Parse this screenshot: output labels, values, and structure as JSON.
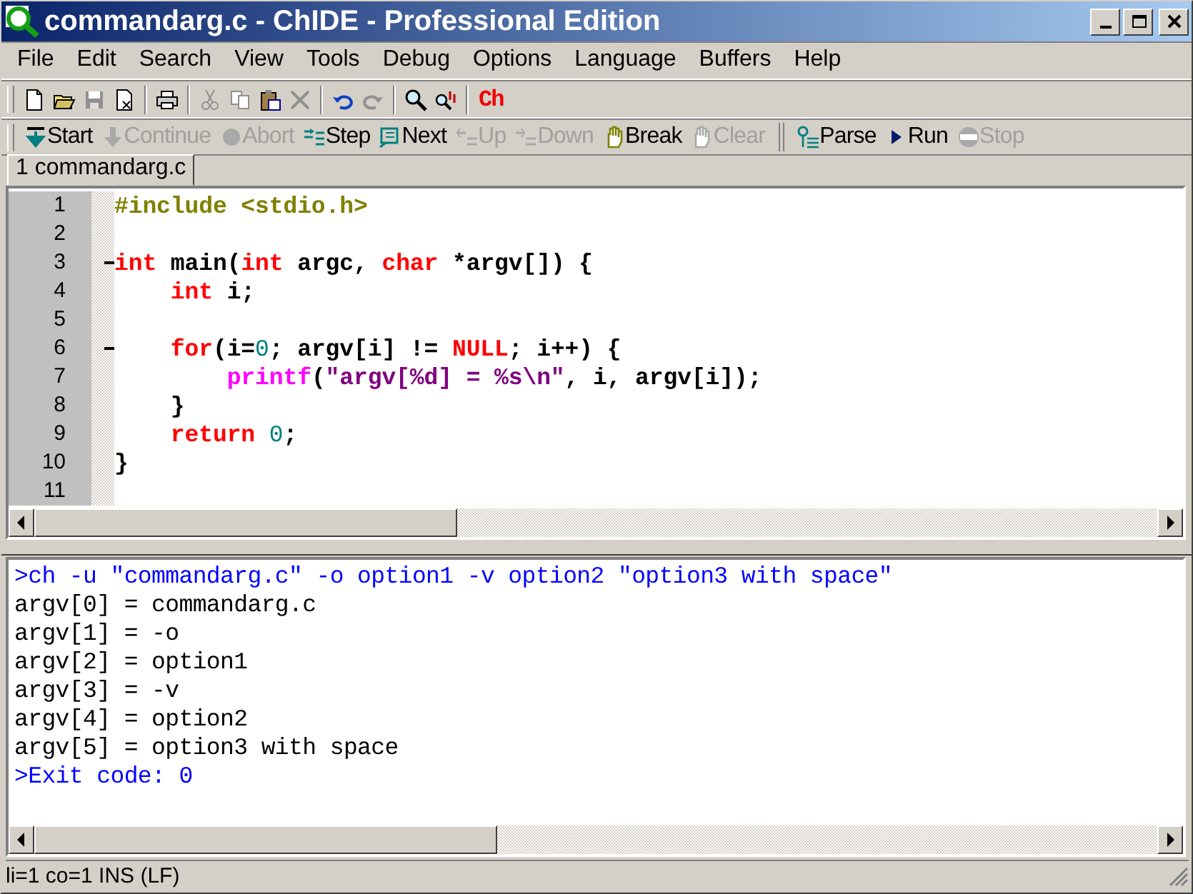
{
  "window": {
    "title": "commandarg.c - ChIDE - Professional Edition"
  },
  "menu": [
    "File",
    "Edit",
    "Search",
    "View",
    "Tools",
    "Debug",
    "Options",
    "Language",
    "Buffers",
    "Help"
  ],
  "toolbar": [
    {
      "kind": "icon",
      "disabled": false
    },
    {
      "kind": "icon",
      "disabled": false
    },
    {
      "kind": "icon",
      "disabled": true
    },
    {
      "kind": "icon",
      "disabled": false
    },
    {
      "kind": "separator"
    },
    {
      "kind": "icon",
      "disabled": false
    },
    {
      "kind": "separator"
    },
    {
      "kind": "icon",
      "disabled": true
    },
    {
      "kind": "icon",
      "disabled": true
    },
    {
      "kind": "icon",
      "disabled": false
    },
    {
      "kind": "icon",
      "disabled": true
    },
    {
      "kind": "separator"
    },
    {
      "kind": "icon",
      "disabled": false
    },
    {
      "kind": "icon",
      "disabled": true
    },
    {
      "kind": "separator"
    },
    {
      "kind": "icon",
      "disabled": false
    },
    {
      "kind": "icon",
      "disabled": false
    },
    {
      "kind": "separator"
    },
    {
      "kind": "text",
      "label": "Ch",
      "disabled": false
    }
  ],
  "debug_toolbar": [
    {
      "kind": "button",
      "label": "Start",
      "disabled": false
    },
    {
      "kind": "button",
      "label": "Continue",
      "disabled": true
    },
    {
      "kind": "button",
      "label": "Abort",
      "disabled": true
    },
    {
      "kind": "button",
      "label": "Step",
      "disabled": false
    },
    {
      "kind": "button",
      "label": "Next",
      "disabled": false
    },
    {
      "kind": "button",
      "label": "Up",
      "disabled": true
    },
    {
      "kind": "button",
      "label": "Down",
      "disabled": true
    },
    {
      "kind": "button",
      "label": "Break",
      "disabled": false
    },
    {
      "kind": "button",
      "label": "Clear",
      "disabled": true
    },
    {
      "kind": "separator"
    },
    {
      "kind": "button",
      "label": "Parse",
      "disabled": false
    },
    {
      "kind": "button",
      "label": "Run",
      "disabled": false
    },
    {
      "kind": "button",
      "label": "Stop",
      "disabled": true
    }
  ],
  "tabs": [
    {
      "label": "1 commandarg.c",
      "selected": true
    }
  ],
  "editor": {
    "lines": [
      {
        "number": "1",
        "fold": false,
        "tokens": [
          {
            "kind": "preprocessor",
            "text": "#include <stdio.h>"
          }
        ]
      },
      {
        "number": "2",
        "fold": false
      },
      {
        "number": "3",
        "fold": true,
        "tokens": [
          {
            "kind": "keyword",
            "text": "int"
          },
          {
            "kind": "plain",
            "text": " main("
          },
          {
            "kind": "keyword",
            "text": "int"
          },
          {
            "kind": "plain",
            "text": " argc, "
          },
          {
            "kind": "keyword",
            "text": "char"
          },
          {
            "kind": "plain",
            "text": " *argv[]) {"
          }
        ]
      },
      {
        "number": "4",
        "fold": false,
        "tokens": [
          {
            "kind": "keyword",
            "text": "    int"
          },
          {
            "kind": "plain",
            "text": " i;"
          }
        ]
      },
      {
        "number": "5",
        "fold": false
      },
      {
        "number": "6",
        "fold": true,
        "tokens": [
          {
            "kind": "keyword",
            "text": "    for"
          },
          {
            "kind": "plain",
            "text": "(i="
          },
          {
            "kind": "number",
            "text": "0"
          },
          {
            "kind": "plain",
            "text": "; argv[i] != "
          },
          {
            "kind": "keyword",
            "text": "NULL"
          },
          {
            "kind": "plain",
            "text": "; i++) {"
          }
        ]
      },
      {
        "number": "7",
        "fold": false,
        "tokens": [
          {
            "kind": "function",
            "text": "        printf"
          },
          {
            "kind": "plain",
            "text": "("
          },
          {
            "kind": "string",
            "text": "\"argv[%d] = %s\\n\""
          },
          {
            "kind": "plain",
            "text": ", i, argv[i]);"
          }
        ]
      },
      {
        "number": "8",
        "fold": false,
        "tokens": [
          {
            "kind": "plain",
            "text": "    }"
          }
        ]
      },
      {
        "number": "9",
        "fold": false,
        "tokens": [
          {
            "kind": "keyword",
            "text": "    return"
          },
          {
            "kind": "number",
            "text": " 0"
          },
          {
            "kind": "plain",
            "text": ";"
          }
        ]
      },
      {
        "number": "10",
        "fold": false,
        "tokens": [
          {
            "kind": "plain",
            "text": "}"
          }
        ]
      },
      {
        "number": "11",
        "fold": false
      }
    ]
  },
  "output": {
    "lines": [
      {
        "kind": "command",
        "text": ">ch -u \"commandarg.c\" -o option1 -v option2 \"option3 with space\""
      },
      {
        "kind": "plain",
        "text": "argv[0] = commandarg.c"
      },
      {
        "kind": "plain",
        "text": "argv[1] = -o"
      },
      {
        "kind": "plain",
        "text": "argv[2] = option1"
      },
      {
        "kind": "plain",
        "text": "argv[3] = -v"
      },
      {
        "kind": "plain",
        "text": "argv[4] = option2"
      },
      {
        "kind": "plain",
        "text": "argv[5] = option3 with space"
      },
      {
        "kind": "command",
        "text": ">Exit code: 0"
      }
    ]
  },
  "status_bar": {
    "text": "li=1 co=1 INS (LF)"
  }
}
